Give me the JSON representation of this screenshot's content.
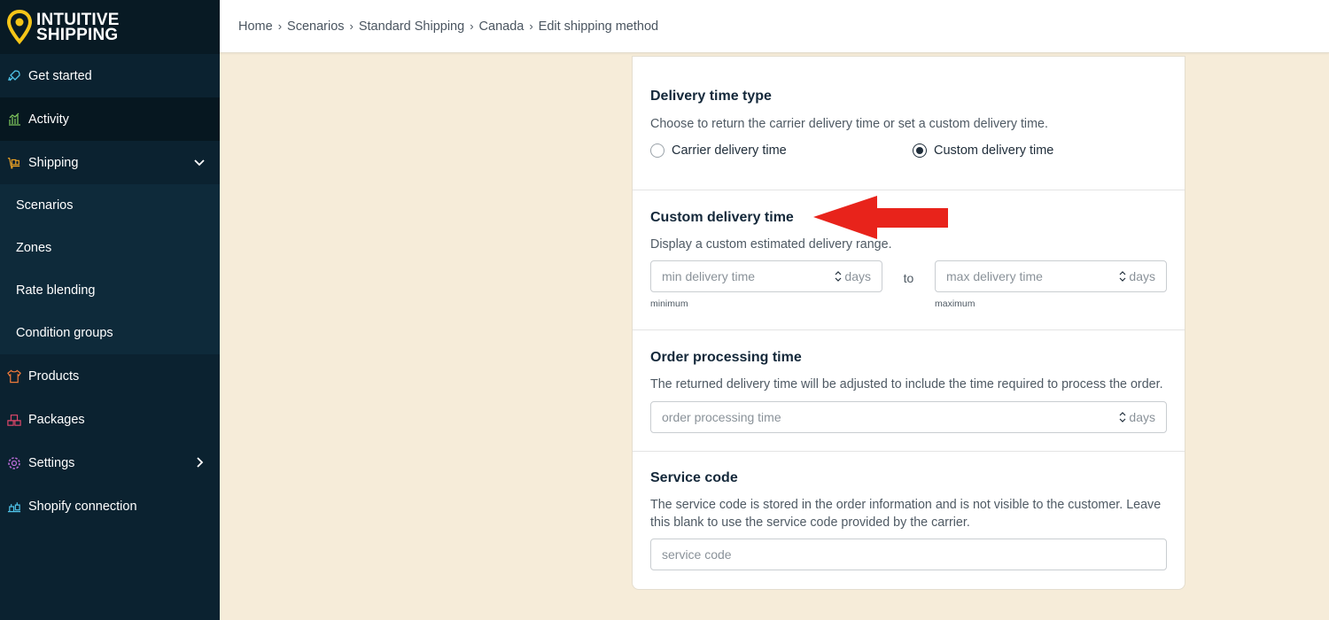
{
  "app": {
    "logo_line1": "INTUITIVE",
    "logo_line2": "SHIPPING"
  },
  "sidebar": {
    "items": [
      {
        "label": "Get started"
      },
      {
        "label": "Activity"
      },
      {
        "label": "Shipping"
      },
      {
        "label": "Products"
      },
      {
        "label": "Packages"
      },
      {
        "label": "Settings"
      },
      {
        "label": "Shopify connection"
      }
    ],
    "sub_items": [
      {
        "label": "Scenarios"
      },
      {
        "label": "Zones"
      },
      {
        "label": "Rate blending"
      },
      {
        "label": "Condition groups"
      }
    ]
  },
  "breadcrumb": {
    "items": [
      "Home",
      "Scenarios",
      "Standard Shipping",
      "Canada"
    ],
    "current": "Edit shipping method"
  },
  "delivery_type": {
    "title": "Delivery time type",
    "description": "Choose to return the carrier delivery time or set a custom delivery time.",
    "option_carrier": "Carrier delivery time",
    "option_custom": "Custom delivery time",
    "selected": "Custom delivery time"
  },
  "custom_delivery": {
    "title": "Custom delivery time",
    "description": "Display a custom estimated delivery range.",
    "min_placeholder": "min delivery time",
    "max_placeholder": "max delivery time",
    "unit": "days",
    "to_label": "to",
    "min_hint": "minimum",
    "max_hint": "maximum"
  },
  "order_processing": {
    "title": "Order processing time",
    "description": "The returned delivery time will be adjusted to include the time required to process the order.",
    "placeholder": "order processing time",
    "unit": "days"
  },
  "service_code": {
    "title": "Service code",
    "description": "The service code is stored in the order information and is not visible to the customer. Leave this blank to use the service code provided by the carrier.",
    "placeholder": "service code"
  },
  "colors": {
    "sidebar_bg": "#0b2230",
    "page_bg": "#f6ecd9",
    "logo_accent": "#f5c518",
    "annotation_arrow": "#e8231b"
  }
}
